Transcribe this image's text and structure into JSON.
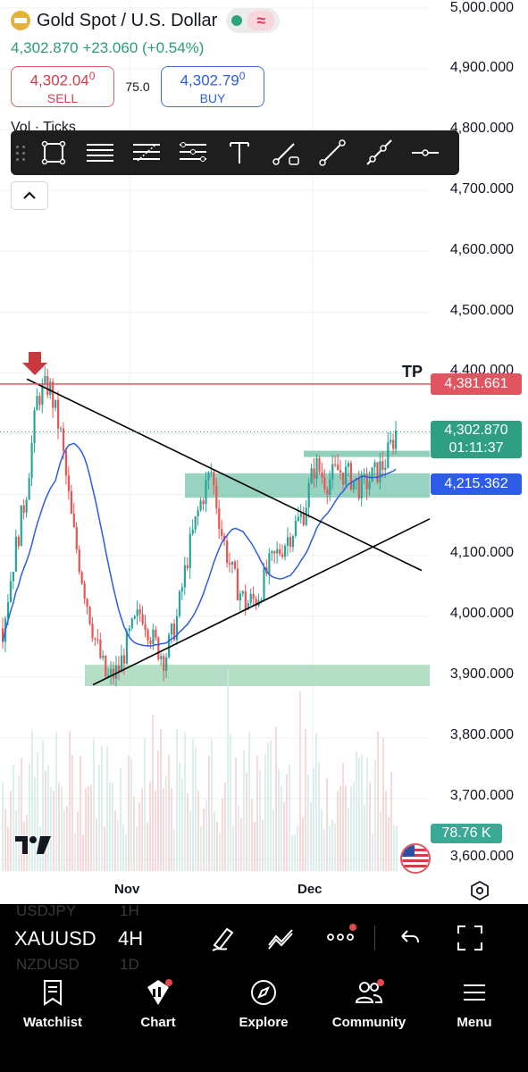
{
  "header": {
    "title": "Gold Spot / U.S. Dollar",
    "quote": "4,302.870 +23.060 (+0.54%)",
    "sell": {
      "price_main": "4,302.04",
      "price_sup": "0",
      "label": "SELL"
    },
    "buy": {
      "price_main": "4,302.79",
      "price_sup": "0",
      "label": "BUY"
    },
    "spread": "75.0",
    "volume_label": "Vol · Ticks"
  },
  "price_axis": [
    "5,000.000",
    "4,900.000",
    "4,800.000",
    "4,700.000",
    "4,600.000",
    "4,500.000",
    "4,400.000",
    "4,100.000",
    "4,000.000",
    "3,900.000",
    "3,800.000",
    "3,700.000",
    "3,600.000"
  ],
  "tags": {
    "tp_text": "TP",
    "tp_price": "4,381.661",
    "last_price": "4,302.870",
    "countdown": "01:11:37",
    "ma_price": "4,215.362",
    "volume": "78.76 K"
  },
  "time_axis": {
    "nov": "Nov",
    "dec": "Dec"
  },
  "chart_data": {
    "type": "candlestick",
    "symbol": "XAUUSD",
    "interval": "4H",
    "ylim": [
      3580,
      5000
    ],
    "x_labels": [
      "Nov",
      "Dec"
    ],
    "approx_close_path": [
      3980,
      4100,
      4200,
      4360,
      4381,
      4300,
      4150,
      4050,
      3960,
      3895,
      3910,
      3970,
      4010,
      3960,
      3930,
      3990,
      4100,
      4180,
      4240,
      4130,
      4060,
      4020,
      4030,
      4080,
      4110,
      4140,
      4170,
      4250,
      4220,
      4240,
      4230,
      4210,
      4230,
      4250,
      4303
    ],
    "moving_average_last": 4215.362,
    "tp_level": 4381.661,
    "last_price": 4302.87,
    "annotations": [
      "TP",
      "triangle trendlines",
      "support zone ~3,885–3,920",
      "resistance zone ~4,200–4,235"
    ],
    "colors": {
      "up": "#26a69a",
      "down": "#ef5350",
      "ma": "#2d5ce6",
      "tp_line": "#e05560",
      "zone": "#9bd3b1"
    }
  },
  "interval_bar": {
    "symbol": "XAUUSD",
    "interval": "4H",
    "ghost_items": [
      "USDJPY",
      "1H",
      "NZDUSD",
      "1D"
    ],
    "icons": [
      "brush-icon",
      "candles-icon",
      "more-icon",
      "undo-icon",
      "fullscreen-icon"
    ]
  },
  "tabbar": [
    {
      "label": "Watchlist",
      "icon": "bookmark-icon"
    },
    {
      "label": "Chart",
      "icon": "chart-icon"
    },
    {
      "label": "Explore",
      "icon": "compass-icon"
    },
    {
      "label": "Community",
      "icon": "people-icon"
    },
    {
      "label": "Menu",
      "icon": "menu-icon"
    }
  ]
}
